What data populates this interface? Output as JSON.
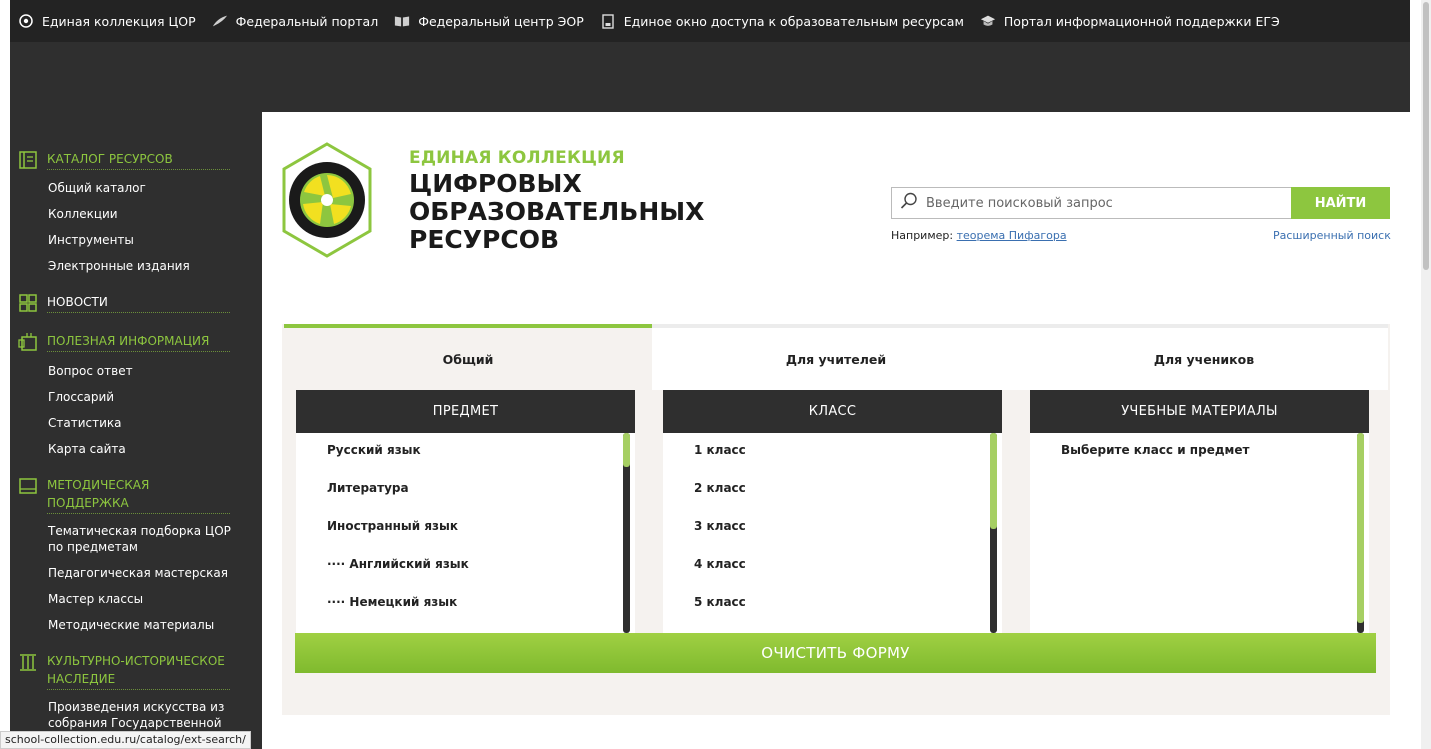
{
  "topbar": {
    "links": [
      {
        "label": "Единая коллекция ЦОР",
        "icon": "disc-icon"
      },
      {
        "label": "Федеральный портал",
        "icon": "feather-icon"
      },
      {
        "label": "Федеральный центр ЭОР",
        "icon": "book-icon"
      },
      {
        "label": "Единое окно доступа к образовательным ресурсам",
        "icon": "document-icon"
      },
      {
        "label": "Портал информационной поддержки ЕГЭ",
        "icon": "cap-icon"
      }
    ]
  },
  "sidebar": {
    "sections": [
      {
        "title": "КАТАЛОГ РЕСУРСОВ",
        "icon": "catalog-icon",
        "items": [
          "Общий каталог",
          "Коллекции",
          "Инструменты",
          "Электронные издания"
        ]
      },
      {
        "title": "НОВОСТИ",
        "icon": "grid-icon",
        "items": []
      },
      {
        "title": "ПОЛЕЗНАЯ ИНФОРМАЦИЯ",
        "icon": "info-icon",
        "items": [
          "Вопрос ответ",
          "Глоссарий",
          "Статистика",
          "Карта сайта"
        ]
      },
      {
        "title": "МЕТОДИЧЕСКАЯ ПОДДЕРЖКА",
        "icon": "monitor-icon",
        "items": [
          "Тематическая подборка ЦОР по предметам",
          "Педагогическая мастерская",
          "Мастер классы",
          "Методические материалы"
        ]
      },
      {
        "title": "КУЛЬТУРНО-ИСТОРИЧЕСКОЕ НАСЛЕДИЕ",
        "icon": "columns-icon",
        "items": [
          "Произведения искусства из собрания Государственной"
        ]
      }
    ]
  },
  "brand": {
    "small": "ЕДИНАЯ КОЛЛЕКЦИЯ",
    "line1": "ЦИФРОВЫХ",
    "line2": "ОБРАЗОВАТЕЛЬНЫХ",
    "line3": "РЕСУРСОВ",
    "logo_text": "ЕДИНАЯ КОЛЛЕКЦИЯ ЦИФРОВЫХ ОБРАЗОВАТЕЛЬНЫХ РЕСУРСОВ"
  },
  "search": {
    "placeholder": "Введите поисковый запрос",
    "button": "НАЙТИ",
    "example_label": "Например:",
    "example_link": "теорема Пифагора",
    "advanced": "Расширенный поиск"
  },
  "tabs": [
    "Общий",
    "Для учителей",
    "Для учеников"
  ],
  "columns": [
    {
      "title": "ПРЕДМЕТ",
      "items": [
        "Русский язык",
        "Литература",
        "Иностранный язык",
        "···· Английский язык",
        "···· Немецкий язык"
      ]
    },
    {
      "title": "КЛАСС",
      "items": [
        "1 класс",
        "2 класс",
        "3 класс",
        "4 класс",
        "5 класс"
      ]
    },
    {
      "title": "УЧЕБНЫЕ МАТЕРИАЛЫ",
      "items": [
        "Выберите класс и предмет"
      ]
    }
  ],
  "clear_button": "ОЧИСТИТЬ ФОРМУ",
  "status_url": "school-collection.edu.ru/catalog/ext-search/",
  "colors": {
    "accent": "#8dc63f",
    "dark": "#2f2f2f",
    "link": "#3a6fb0"
  }
}
